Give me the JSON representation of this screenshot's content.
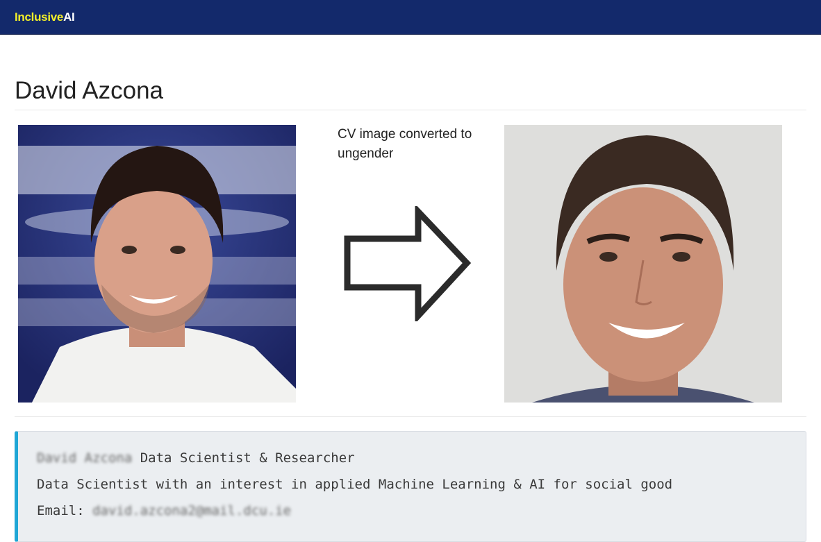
{
  "navbar": {
    "brand_part1": "Inclusive",
    "brand_part2": "AI",
    "bg_color": "#13296b",
    "brand_accent": "#f2ee2a"
  },
  "page": {
    "title": "David Azcona"
  },
  "comparison": {
    "caption": "CV image converted to ungender",
    "arrow_icon": "right-arrow-outline-icon",
    "original_photo": "original-portrait-photo",
    "converted_photo": "ungendered-portrait-photo"
  },
  "profile": {
    "name": "David Azcona",
    "headline": " Data Scientist & Researcher",
    "bio": "Data Scientist with an interest in applied Machine Learning & AI for social good",
    "email_label": "Email: ",
    "email": "david.azcona2@mail.dcu.ie",
    "accent_color": "#1fa6d6"
  }
}
